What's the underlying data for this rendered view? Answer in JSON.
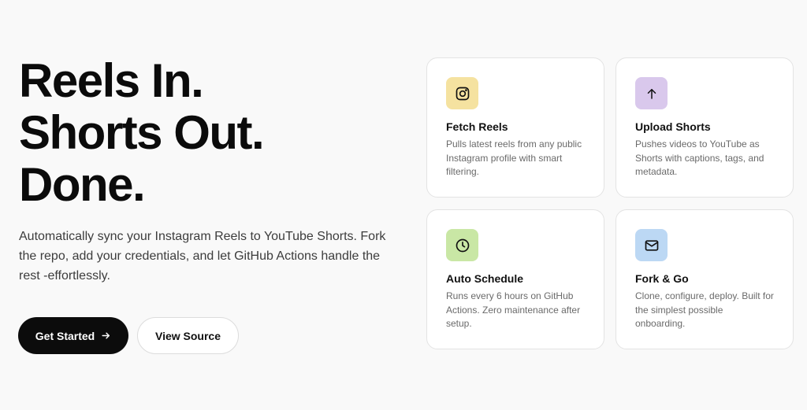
{
  "hero": {
    "headline": [
      "Reels In.",
      "Shorts Out.",
      "Done."
    ],
    "description": "Automatically sync your Instagram Reels to YouTube Shorts. Fork the repo, add your credentials, and let GitHub Actions handle the rest -effortlessly."
  },
  "actions": {
    "primary_label": "Get Started",
    "secondary_label": "View Source"
  },
  "features": [
    {
      "icon": "instagram-icon",
      "icon_bg": "#f5e2a0",
      "title": "Fetch Reels",
      "text": "Pulls latest reels from any public Instagram profile with smart filtering."
    },
    {
      "icon": "arrow-up-icon",
      "icon_bg": "#d9c8ec",
      "title": "Upload Shorts",
      "text": "Pushes videos to YouTube as Shorts with captions, tags, and metadata."
    },
    {
      "icon": "clock-icon",
      "icon_bg": "#c9e7a5",
      "title": "Auto Schedule",
      "text": "Runs every 6 hours on GitHub Actions. Zero maintenance after setup."
    },
    {
      "icon": "mail-icon",
      "icon_bg": "#bcd8f4",
      "title": "Fork & Go",
      "text": "Clone, configure, deploy. Built for the simplest possible onboarding."
    }
  ],
  "colors": {
    "background": "#f9f9f9",
    "primary_button": "#0c0c0c",
    "card_border": "#e3e3e3"
  }
}
